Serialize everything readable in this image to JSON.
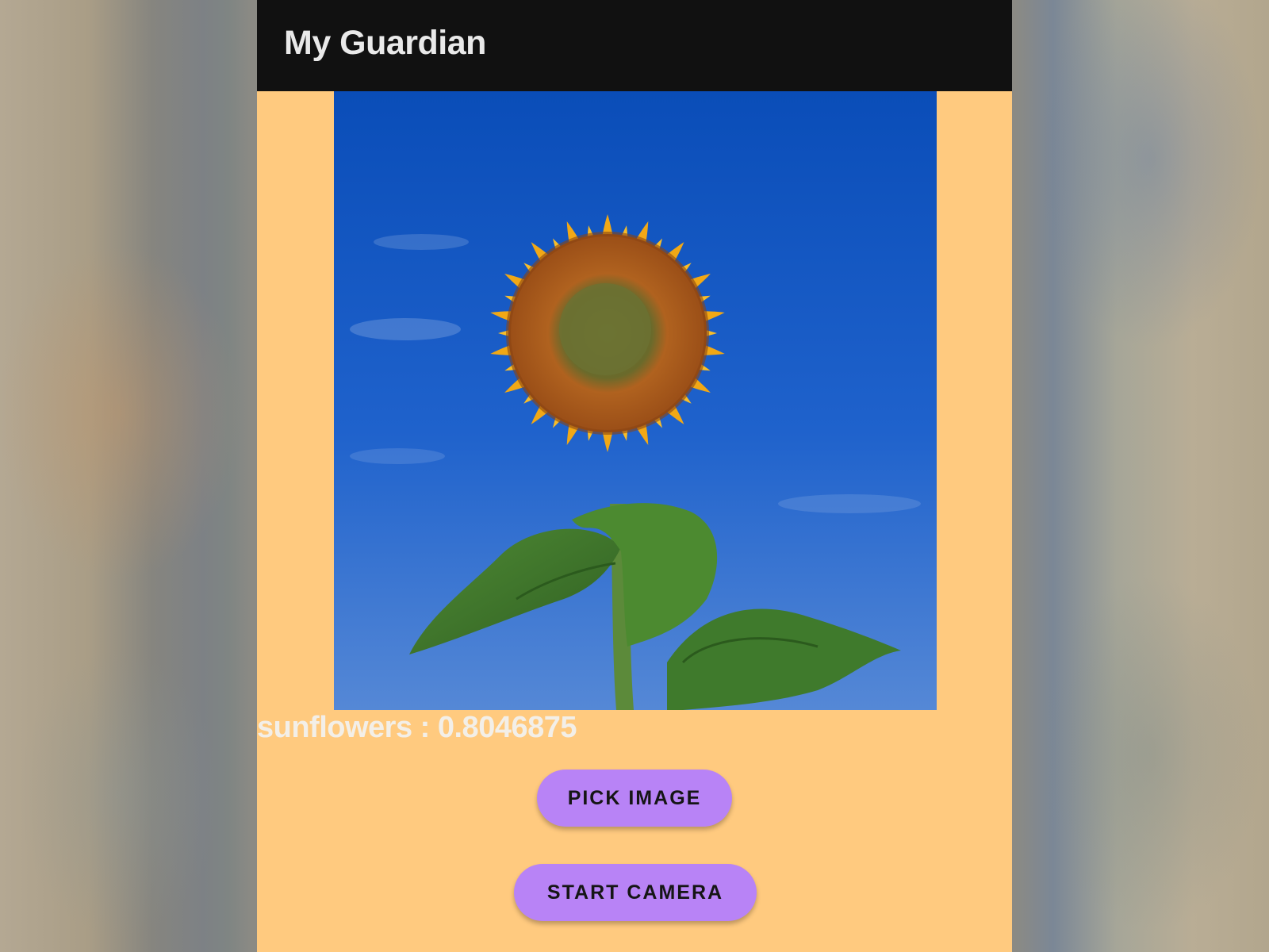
{
  "app_bar": {
    "title": "My Guardian",
    "background": "#111111"
  },
  "screen": {
    "background": "#ffca7f"
  },
  "preview_image": {
    "subject": "sunflower against blue sky"
  },
  "result": {
    "text": "sunflowers : 0.8046875"
  },
  "buttons": {
    "pick_image": "PICK IMAGE",
    "start_camera": "START CAMERA",
    "color": "#b883f6"
  }
}
